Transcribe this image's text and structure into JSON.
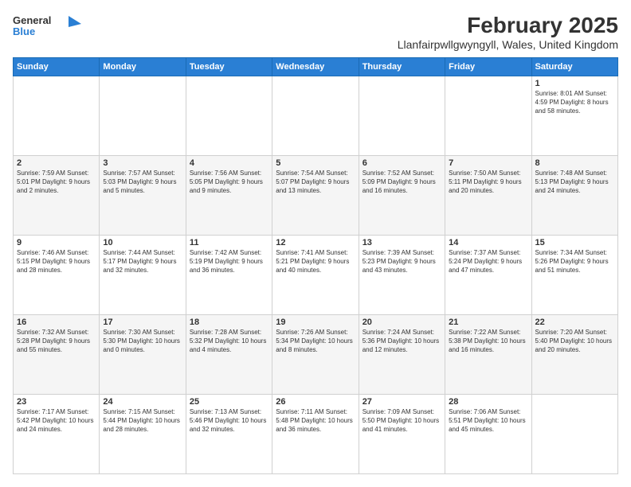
{
  "header": {
    "logo_general": "General",
    "logo_blue": "Blue",
    "main_title": "February 2025",
    "subtitle": "Llanfairpwllgwyngyll, Wales, United Kingdom"
  },
  "days_of_week": [
    "Sunday",
    "Monday",
    "Tuesday",
    "Wednesday",
    "Thursday",
    "Friday",
    "Saturday"
  ],
  "weeks": [
    [
      {
        "day": "",
        "info": ""
      },
      {
        "day": "",
        "info": ""
      },
      {
        "day": "",
        "info": ""
      },
      {
        "day": "",
        "info": ""
      },
      {
        "day": "",
        "info": ""
      },
      {
        "day": "",
        "info": ""
      },
      {
        "day": "1",
        "info": "Sunrise: 8:01 AM\nSunset: 4:59 PM\nDaylight: 8 hours and 58 minutes."
      }
    ],
    [
      {
        "day": "2",
        "info": "Sunrise: 7:59 AM\nSunset: 5:01 PM\nDaylight: 9 hours and 2 minutes."
      },
      {
        "day": "3",
        "info": "Sunrise: 7:57 AM\nSunset: 5:03 PM\nDaylight: 9 hours and 5 minutes."
      },
      {
        "day": "4",
        "info": "Sunrise: 7:56 AM\nSunset: 5:05 PM\nDaylight: 9 hours and 9 minutes."
      },
      {
        "day": "5",
        "info": "Sunrise: 7:54 AM\nSunset: 5:07 PM\nDaylight: 9 hours and 13 minutes."
      },
      {
        "day": "6",
        "info": "Sunrise: 7:52 AM\nSunset: 5:09 PM\nDaylight: 9 hours and 16 minutes."
      },
      {
        "day": "7",
        "info": "Sunrise: 7:50 AM\nSunset: 5:11 PM\nDaylight: 9 hours and 20 minutes."
      },
      {
        "day": "8",
        "info": "Sunrise: 7:48 AM\nSunset: 5:13 PM\nDaylight: 9 hours and 24 minutes."
      }
    ],
    [
      {
        "day": "9",
        "info": "Sunrise: 7:46 AM\nSunset: 5:15 PM\nDaylight: 9 hours and 28 minutes."
      },
      {
        "day": "10",
        "info": "Sunrise: 7:44 AM\nSunset: 5:17 PM\nDaylight: 9 hours and 32 minutes."
      },
      {
        "day": "11",
        "info": "Sunrise: 7:42 AM\nSunset: 5:19 PM\nDaylight: 9 hours and 36 minutes."
      },
      {
        "day": "12",
        "info": "Sunrise: 7:41 AM\nSunset: 5:21 PM\nDaylight: 9 hours and 40 minutes."
      },
      {
        "day": "13",
        "info": "Sunrise: 7:39 AM\nSunset: 5:23 PM\nDaylight: 9 hours and 43 minutes."
      },
      {
        "day": "14",
        "info": "Sunrise: 7:37 AM\nSunset: 5:24 PM\nDaylight: 9 hours and 47 minutes."
      },
      {
        "day": "15",
        "info": "Sunrise: 7:34 AM\nSunset: 5:26 PM\nDaylight: 9 hours and 51 minutes."
      }
    ],
    [
      {
        "day": "16",
        "info": "Sunrise: 7:32 AM\nSunset: 5:28 PM\nDaylight: 9 hours and 55 minutes."
      },
      {
        "day": "17",
        "info": "Sunrise: 7:30 AM\nSunset: 5:30 PM\nDaylight: 10 hours and 0 minutes."
      },
      {
        "day": "18",
        "info": "Sunrise: 7:28 AM\nSunset: 5:32 PM\nDaylight: 10 hours and 4 minutes."
      },
      {
        "day": "19",
        "info": "Sunrise: 7:26 AM\nSunset: 5:34 PM\nDaylight: 10 hours and 8 minutes."
      },
      {
        "day": "20",
        "info": "Sunrise: 7:24 AM\nSunset: 5:36 PM\nDaylight: 10 hours and 12 minutes."
      },
      {
        "day": "21",
        "info": "Sunrise: 7:22 AM\nSunset: 5:38 PM\nDaylight: 10 hours and 16 minutes."
      },
      {
        "day": "22",
        "info": "Sunrise: 7:20 AM\nSunset: 5:40 PM\nDaylight: 10 hours and 20 minutes."
      }
    ],
    [
      {
        "day": "23",
        "info": "Sunrise: 7:17 AM\nSunset: 5:42 PM\nDaylight: 10 hours and 24 minutes."
      },
      {
        "day": "24",
        "info": "Sunrise: 7:15 AM\nSunset: 5:44 PM\nDaylight: 10 hours and 28 minutes."
      },
      {
        "day": "25",
        "info": "Sunrise: 7:13 AM\nSunset: 5:46 PM\nDaylight: 10 hours and 32 minutes."
      },
      {
        "day": "26",
        "info": "Sunrise: 7:11 AM\nSunset: 5:48 PM\nDaylight: 10 hours and 36 minutes."
      },
      {
        "day": "27",
        "info": "Sunrise: 7:09 AM\nSunset: 5:50 PM\nDaylight: 10 hours and 41 minutes."
      },
      {
        "day": "28",
        "info": "Sunrise: 7:06 AM\nSunset: 5:51 PM\nDaylight: 10 hours and 45 minutes."
      },
      {
        "day": "",
        "info": ""
      }
    ]
  ]
}
